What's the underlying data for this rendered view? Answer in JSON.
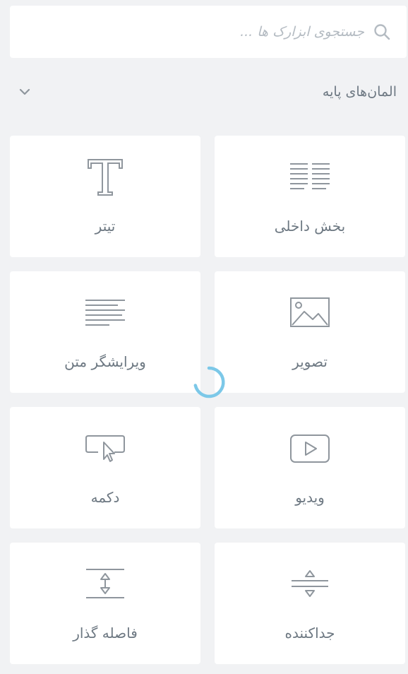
{
  "search": {
    "placeholder": "جستجوی ابزارک ها ..."
  },
  "category": {
    "title": "المان‌های پایه",
    "chevron": "chevron-down-icon"
  },
  "widgets": [
    {
      "label": "بخش داخلی",
      "icon": "inner-section-icon"
    },
    {
      "label": "تیتر",
      "icon": "heading-icon"
    },
    {
      "label": "تصویر",
      "icon": "image-icon"
    },
    {
      "label": "ویرایشگر متن",
      "icon": "text-editor-icon"
    },
    {
      "label": "ویدیو",
      "icon": "video-icon"
    },
    {
      "label": "دکمه",
      "icon": "button-icon"
    },
    {
      "label": "جداکننده",
      "icon": "divider-icon"
    },
    {
      "label": "فاصله گذار",
      "icon": "spacer-icon"
    }
  ],
  "colors": {
    "background": "#f1f2f4",
    "card": "#ffffff",
    "icon_stroke": "#8f969d",
    "label_text": "#6d7882",
    "placeholder": "#b4bbc2",
    "spinner": "#7cc8e8"
  }
}
